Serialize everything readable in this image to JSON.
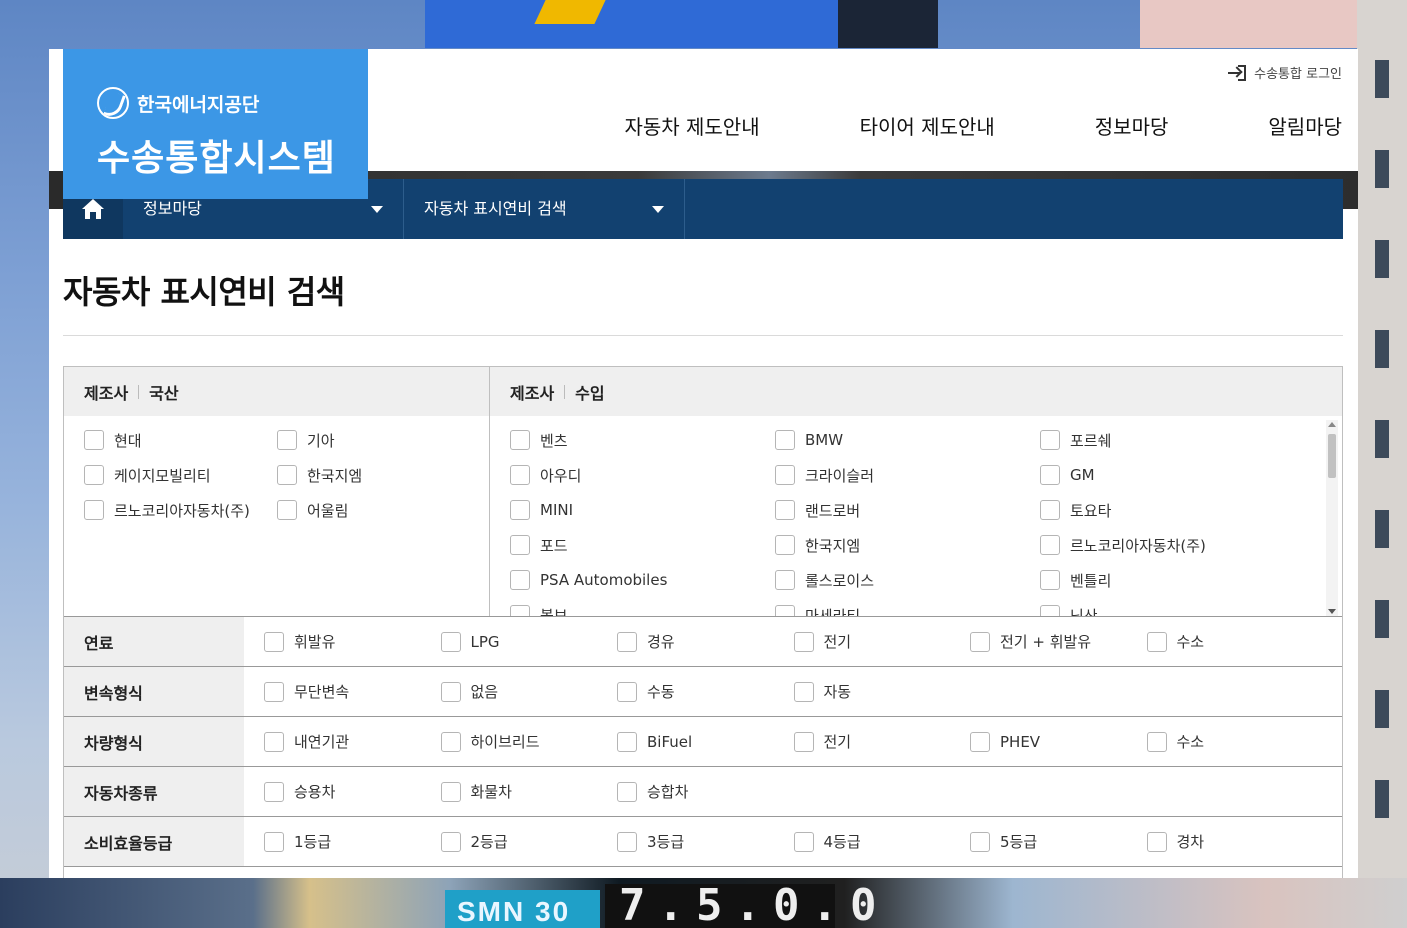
{
  "site": {
    "org_name": "한국에너지공단",
    "system_name": "수송통합시스템",
    "login_label": "수송통합 로그인"
  },
  "gnb": [
    "자동차 제도안내",
    "타이어 제도안내",
    "정보마당",
    "알림마당"
  ],
  "subnav": {
    "level1": "정보마당",
    "level2": "자동차 표시연비 검색"
  },
  "page_title": "자동차 표시연비 검색",
  "manufacturer": {
    "label": "제조사",
    "domestic": {
      "title": "국산",
      "items": [
        "현대",
        "기아",
        "케이지모빌리티",
        "한국지엠",
        "르노코리아자동차(주)",
        "어울림"
      ]
    },
    "imported": {
      "title": "수입",
      "items": [
        "벤츠",
        "BMW",
        "포르쉐",
        "아우디",
        "크라이슬러",
        "GM",
        "MINI",
        "랜드로버",
        "토요타",
        "포드",
        "한국지엠",
        "르노코리아자동차(주)",
        "PSA Automobiles",
        "롤스로이스",
        "벤틀리",
        "볼보",
        "마세라티",
        "닛산"
      ]
    }
  },
  "filters": [
    {
      "label": "연료",
      "options": [
        "휘발유",
        "LPG",
        "경유",
        "전기",
        "전기 + 휘발유",
        "수소"
      ]
    },
    {
      "label": "변속형식",
      "options": [
        "무단변속",
        "없음",
        "수동",
        "자동"
      ]
    },
    {
      "label": "차량형식",
      "options": [
        "내연기관",
        "하이브리드",
        "BiFuel",
        "전기",
        "PHEV",
        "수소"
      ]
    },
    {
      "label": "자동차종류",
      "options": [
        "승용차",
        "화물차",
        "승합차"
      ]
    },
    {
      "label": "소비효율등급",
      "options": [
        "1등급",
        "2등급",
        "3등급",
        "4등급",
        "5등급",
        "경차"
      ]
    }
  ],
  "background": {
    "sign_text": "SMN 30",
    "digits_text": "7.5.0.0"
  }
}
